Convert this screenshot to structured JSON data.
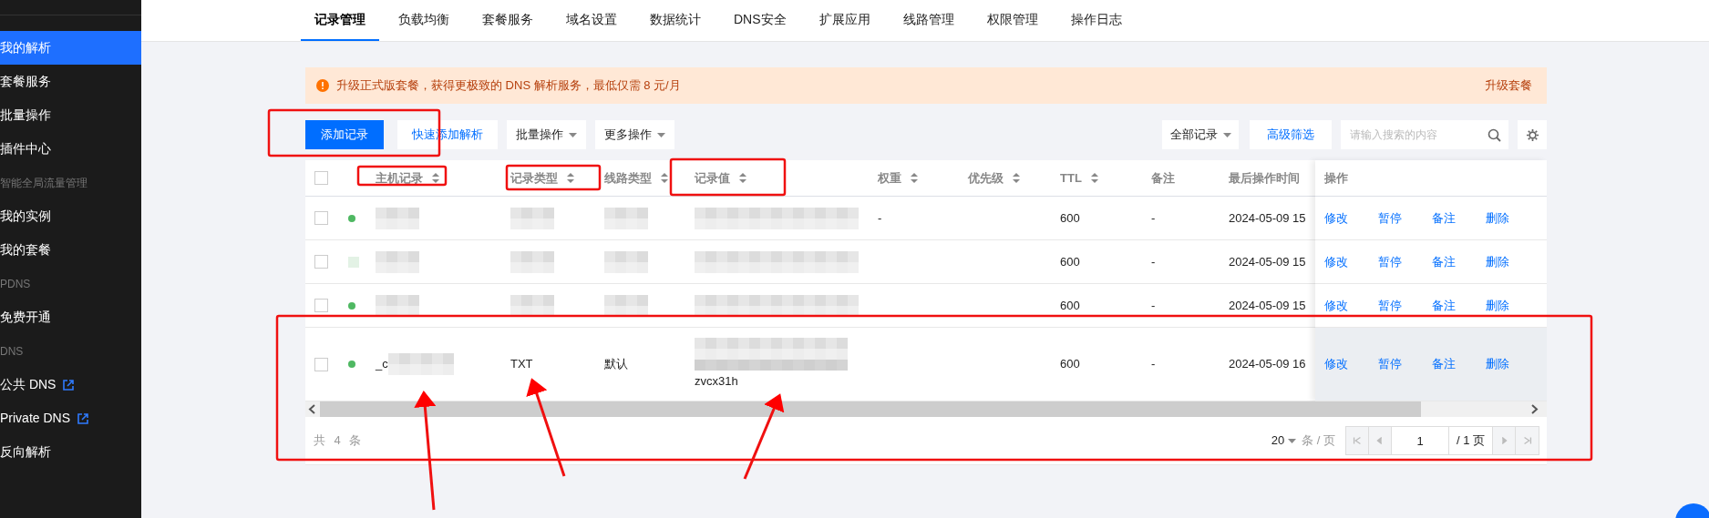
{
  "sidebar": {
    "items": [
      {
        "kind": "item",
        "label": "我的解析",
        "selected": true
      },
      {
        "kind": "item",
        "label": "套餐服务",
        "selected": false
      },
      {
        "kind": "item",
        "label": "批量操作",
        "selected": false
      },
      {
        "kind": "item",
        "label": "插件中心",
        "selected": false
      },
      {
        "kind": "section",
        "label": "智能全局流量管理"
      },
      {
        "kind": "item",
        "label": "我的实例",
        "selected": false
      },
      {
        "kind": "item",
        "label": "我的套餐",
        "selected": false
      },
      {
        "kind": "section",
        "label": "PDNS"
      },
      {
        "kind": "item",
        "label": "免费开通",
        "selected": false
      },
      {
        "kind": "section",
        "label": "DNS"
      },
      {
        "kind": "item",
        "label": "公共 DNS",
        "selected": false,
        "external": true
      },
      {
        "kind": "item",
        "label": "Private DNS",
        "selected": false,
        "external": true
      },
      {
        "kind": "item",
        "label": "反向解析",
        "selected": false
      }
    ]
  },
  "tabs": [
    {
      "label": "记录管理",
      "selected": true
    },
    {
      "label": "负载均衡",
      "selected": false
    },
    {
      "label": "套餐服务",
      "selected": false
    },
    {
      "label": "域名设置",
      "selected": false
    },
    {
      "label": "数据统计",
      "selected": false
    },
    {
      "label": "DNS安全",
      "selected": false
    },
    {
      "label": "扩展应用",
      "selected": false
    },
    {
      "label": "线路管理",
      "selected": false
    },
    {
      "label": "权限管理",
      "selected": false
    },
    {
      "label": "操作日志",
      "selected": false
    }
  ],
  "banner": {
    "message": "升级正式版套餐，获得更极致的 DNS 解析服务，最低仅需 8 元/月",
    "action": "升级套餐"
  },
  "toolbar": {
    "buttons": [
      {
        "kind": "primary",
        "label": "添加记录"
      },
      {
        "kind": "link",
        "label": "快速添加解析"
      },
      {
        "kind": "dropdown",
        "label": "批量操作"
      },
      {
        "kind": "dropdown",
        "label": "更多操作"
      }
    ],
    "filter": "全部记录",
    "advanced": "高级筛选",
    "search": {
      "placeholder": "请输入搜索的内容"
    }
  },
  "table": {
    "select_all_checked": false,
    "columns": [
      {
        "label": "主机记录",
        "sortable": true
      },
      {
        "label": "记录类型",
        "sortable": true
      },
      {
        "label": "线路类型",
        "sortable": true
      },
      {
        "label": "记录值",
        "sortable": true
      },
      {
        "label": "权重",
        "sortable": true
      },
      {
        "label": "优先级",
        "sortable": true
      },
      {
        "label": "TTL",
        "sortable": true
      },
      {
        "label": "备注",
        "sortable": false
      },
      {
        "label": "最后操作时间",
        "sortable": false
      }
    ],
    "actions_header": "操作",
    "rows": [
      {
        "checked": false,
        "enabled": true,
        "status_redacted": false,
        "hovered": false,
        "cells": [
          {
            "redacted": true
          },
          {
            "redacted": true
          },
          {
            "redacted": true
          },
          {
            "redacted": true
          },
          {
            "text": "-"
          },
          null,
          {
            "text": "600"
          },
          {
            "text": "-"
          },
          {
            "text": "2024-05-09 15"
          }
        ],
        "actions": [
          "修改",
          "暂停",
          "备注",
          "删除"
        ]
      },
      {
        "checked": false,
        "enabled": true,
        "status_redacted": true,
        "hovered": false,
        "cells": [
          {
            "redacted": true
          },
          {
            "redacted": true
          },
          {
            "redacted": true
          },
          {
            "redacted": true
          },
          null,
          null,
          {
            "text": "600"
          },
          {
            "text": "-"
          },
          {
            "text": "2024-05-09 15"
          }
        ],
        "actions": [
          "修改",
          "暂停",
          "备注",
          "删除"
        ]
      },
      {
        "checked": false,
        "enabled": true,
        "status_redacted": false,
        "hovered": false,
        "cells": [
          {
            "redacted": true
          },
          {
            "redacted": true
          },
          {
            "redacted": true
          },
          {
            "redacted": true
          },
          null,
          null,
          {
            "text": "600"
          },
          {
            "text": "-"
          },
          {
            "text": "2024-05-09 15"
          }
        ],
        "actions": [
          "修改",
          "暂停",
          "备注",
          "删除"
        ]
      },
      {
        "checked": false,
        "enabled": true,
        "status_redacted": false,
        "hovered": true,
        "cells": [
          {
            "text": "_c",
            "redacted": true
          },
          {
            "text": "TXT"
          },
          {
            "text": "默认"
          },
          {
            "text": "zvcx31h",
            "redacted": true
          },
          null,
          null,
          {
            "text": "600"
          },
          {
            "text": "-"
          },
          {
            "text": "2024-05-09 16"
          }
        ],
        "actions": [
          "修改",
          "暂停",
          "备注",
          "删除"
        ]
      }
    ]
  },
  "footer": {
    "total": "共 4 条",
    "page_size": "20",
    "page_size_unit": "条 / 页",
    "page": "1",
    "page_total": "/ 1 页"
  }
}
